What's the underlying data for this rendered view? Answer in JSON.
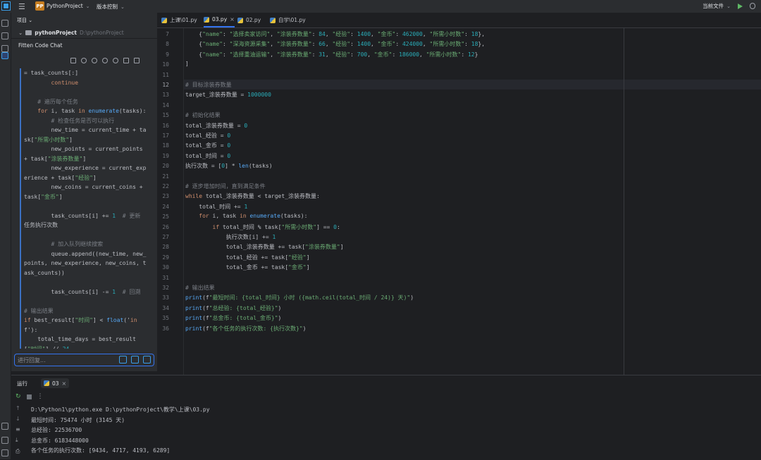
{
  "titlebar": {
    "project_badge": "PP",
    "project_name": "PythonProject",
    "vcs_label": "版本控制",
    "run_config": "当前文件"
  },
  "project_panel": {
    "header": "项目",
    "root_name": "pythonProject",
    "root_path": "D:\\pythonProject"
  },
  "chat": {
    "title": "Fitten Code Chat",
    "input_placeholder": "进行回复..."
  },
  "tabs": [
    {
      "label": "上课\\01.py"
    },
    {
      "label": "03.py"
    },
    {
      "label": "02.py"
    },
    {
      "label": "自学\\01.py"
    }
  ],
  "editor": {
    "current_line": 12,
    "lines": [
      {
        "n": 7,
        "text": "    {\"name\": \"选择卖家访问\", \"涂装券数量\": 84, \"经验\": 1400, \"金币\": 462000, \"所需小时数\": 18},"
      },
      {
        "n": 8,
        "text": "    {\"name\": \"深海资源采集\", \"涂装券数量\": 66, \"经验\": 1400, \"金币\": 424000, \"所需小时数\": 18},"
      },
      {
        "n": 9,
        "text": "    {\"name\": \"选择重油运输\", \"涂装券数量\": 31, \"经验\": 700, \"金币\": 186000, \"所需小时数\": 12}"
      },
      {
        "n": 10,
        "text": "]"
      },
      {
        "n": 11,
        "text": ""
      },
      {
        "n": 12,
        "text": "# 目标涂装券数量"
      },
      {
        "n": 13,
        "text": "target_涂装券数量 = 1000000"
      },
      {
        "n": 14,
        "text": ""
      },
      {
        "n": 15,
        "text": "# 初始化结果"
      },
      {
        "n": 16,
        "text": "total_涂装券数量 = 0"
      },
      {
        "n": 17,
        "text": "total_经验 = 0"
      },
      {
        "n": 18,
        "text": "total_金币 = 0"
      },
      {
        "n": 19,
        "text": "total_时间 = 0"
      },
      {
        "n": 20,
        "text": "执行次数 = [0] * len(tasks)"
      },
      {
        "n": 21,
        "text": ""
      },
      {
        "n": 22,
        "text": "# 逐步增加时间，直到满足条件"
      },
      {
        "n": 23,
        "text": "while total_涂装券数量 < target_涂装券数量:"
      },
      {
        "n": 24,
        "text": "    total_时间 += 1"
      },
      {
        "n": 25,
        "text": "    for i, task in enumerate(tasks):"
      },
      {
        "n": 26,
        "text": "        if total_时间 % task[\"所需小时数\"] == 0:"
      },
      {
        "n": 27,
        "text": "            执行次数[i] += 1"
      },
      {
        "n": 28,
        "text": "            total_涂装券数量 += task[\"涂装券数量\"]"
      },
      {
        "n": 29,
        "text": "            total_经验 += task[\"经验\"]"
      },
      {
        "n": 30,
        "text": "            total_金币 += task[\"金币\"]"
      },
      {
        "n": 31,
        "text": ""
      },
      {
        "n": 32,
        "text": "# 输出结果"
      },
      {
        "n": 33,
        "text": "print(f\"最短时间: {total_时间} 小时 ({math.ceil(total_时间 / 24)} 天)\")"
      },
      {
        "n": 34,
        "text": "print(f\"总经验: {total_经验}\")"
      },
      {
        "n": 35,
        "text": "print(f\"总金币: {total_金币}\")"
      },
      {
        "n": 36,
        "text": "print(f\"各个任务的执行次数: {执行次数}\")"
      }
    ]
  },
  "chat_code": [
    "= task_counts[:]",
    "        continue",
    "",
    "    # 遍历每个任务",
    "    for i, task in enumerate(tasks):",
    "        # 检查任务是否可以执行",
    "        new_time = current_time + ta",
    "sk[\"所需小时数\"]",
    "        new_points = current_points",
    "+ task[\"涂装券数量\"]",
    "        new_experience = current_exp",
    "erience + task[\"经验\"]",
    "        new_coins = current_coins +",
    "task[\"金币\"]",
    "",
    "        task_counts[i] += 1  # 更新",
    "任务执行次数",
    "",
    "        # 加入队列继续搜索",
    "        queue.append((new_time, new_",
    "points, new_experience, new_coins, t",
    "ask_counts))",
    "",
    "        task_counts[i] -= 1  # 回溯",
    "",
    "# 输出结果",
    "if best_result[\"时间\"] < float('in",
    "f'):",
    "    total_time_days = best_result",
    "[\"时间\"] // 24"
  ],
  "run_panel": {
    "header": "运行",
    "tab_label": "03",
    "output": [
      "D:\\Python1\\python.exe D:\\pythonProject\\教学\\上课\\03.py",
      "最短时间: 75474 小时 (3145 天)",
      "总经验: 22536700",
      "总金币: 6183448000",
      "各个任务的执行次数: [9434, 4717, 4193, 6289]"
    ]
  }
}
